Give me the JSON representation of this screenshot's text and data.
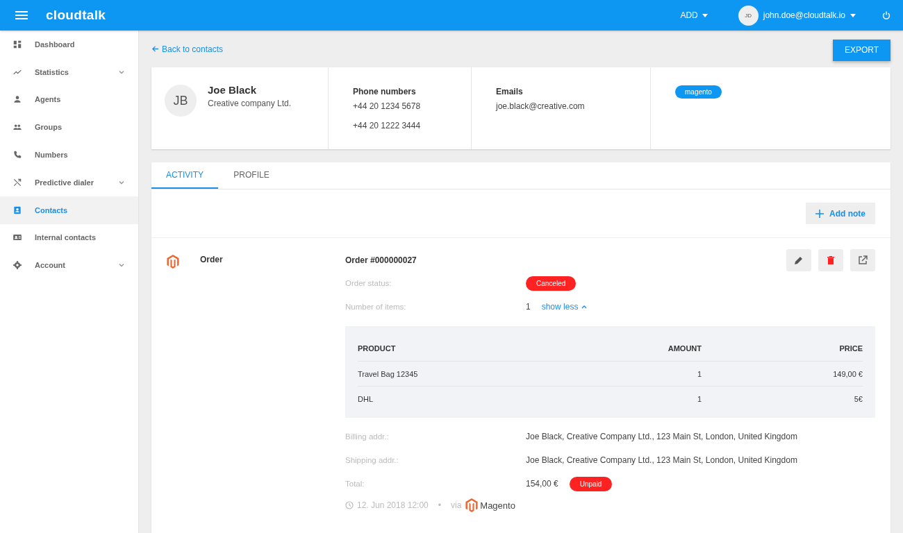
{
  "header": {
    "logo": "cloudtalk",
    "add_menu": "ADD",
    "user": {
      "initials": "JD",
      "email": "john.doe@cloudtalk.io"
    }
  },
  "sidebar": {
    "items": [
      {
        "label": "Dashboard",
        "expandable": false,
        "selected": false
      },
      {
        "label": "Statistics",
        "expandable": true,
        "selected": false
      },
      {
        "label": "Agents",
        "expandable": false,
        "selected": false
      },
      {
        "label": "Groups",
        "expandable": false,
        "selected": false
      },
      {
        "label": "Numbers",
        "expandable": false,
        "selected": false
      },
      {
        "label": "Predictive dialer",
        "expandable": true,
        "selected": false
      },
      {
        "label": "Contacts",
        "expandable": false,
        "selected": true
      },
      {
        "label": "Internal contacts",
        "expandable": false,
        "selected": false
      },
      {
        "label": "Account",
        "expandable": true,
        "selected": false
      }
    ]
  },
  "back_link": "Back to contacts",
  "export_button": "EXPORT",
  "contact": {
    "initials": "JB",
    "name": "Joe Black",
    "company": "Creative company Ltd.",
    "phones_title": "Phone numbers",
    "phones": [
      "+44 20 1234 5678",
      "+44 20 1222 3444"
    ],
    "emails_title": "Emails",
    "emails": [
      "joe.black@creative.com"
    ],
    "tags": [
      "magento"
    ]
  },
  "tabs": [
    {
      "label": "ACTIVITY",
      "selected": true
    },
    {
      "label": "PROFILE",
      "selected": false
    }
  ],
  "add_note_button": "Add note",
  "activity": {
    "type": "Order",
    "title": "Order #000000027",
    "fields": [
      {
        "kind": "badge",
        "label": "Order status:",
        "value": "Canceled"
      },
      {
        "kind": "items",
        "label": "Number of items:",
        "value": "1",
        "link": "show less"
      }
    ],
    "products": {
      "columns": [
        "PRODUCT",
        "AMOUNT",
        "PRICE"
      ],
      "rows": [
        [
          "Travel Bag 12345",
          "1",
          "149,00 €"
        ],
        [
          "DHL",
          "1",
          "5€"
        ]
      ]
    },
    "details": [
      {
        "kind": "text",
        "label": "Billing addr.:",
        "value": "Joe Black, Creative Company Ltd., 123 Main St, London, United Kingdom"
      },
      {
        "kind": "text",
        "label": "Shipping addr.:",
        "value": "Joe Black, Creative Company Ltd., 123 Main St, London, United Kingdom"
      },
      {
        "kind": "total",
        "label": "Total:",
        "value": "154,00 €",
        "badge": "Unpaid"
      }
    ],
    "timestamp": "12. Jun 2018 12:00",
    "separator": "•",
    "via": "via",
    "source": "Magento"
  }
}
